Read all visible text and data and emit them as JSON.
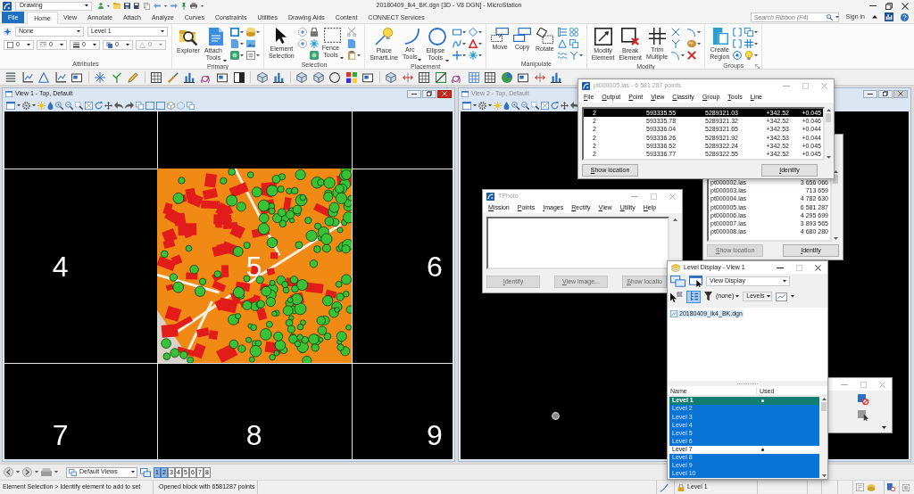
{
  "title_bar": {
    "workspace": "Drawing",
    "title": "20180409_lk4_BK.dgn [3D - V8 DGN] - MicroStation"
  },
  "ribbon": {
    "tabs": [
      {
        "label": "File",
        "kind": "backstage",
        "selected": false
      },
      {
        "label": "Home",
        "kind": "tab",
        "selected": true
      },
      {
        "label": "View",
        "kind": "tab",
        "selected": false
      },
      {
        "label": "Annotate",
        "kind": "tab",
        "selected": false
      },
      {
        "label": "Attach",
        "kind": "tab",
        "selected": false
      },
      {
        "label": "Analyze",
        "kind": "tab",
        "selected": false
      },
      {
        "label": "Curves",
        "kind": "tab",
        "selected": false
      },
      {
        "label": "Constraints",
        "kind": "tab",
        "selected": false
      },
      {
        "label": "Utilities",
        "kind": "tab",
        "selected": false
      },
      {
        "label": "Drawing Aids",
        "kind": "tab",
        "selected": false
      },
      {
        "label": "Content",
        "kind": "tab",
        "selected": false
      },
      {
        "label": "CONNECT Services",
        "kind": "tab",
        "selected": false
      }
    ],
    "search": {
      "placeholder": "Search Ribbon (F4)"
    },
    "sign_in": "Sign in",
    "groups": [
      {
        "label": "Attributes",
        "kind": "attributes",
        "dialog_launcher": false,
        "fields": [
          {
            "value": "None"
          },
          {
            "value": "Level 1"
          }
        ],
        "small_fields": [
          {
            "value": "0",
            "disabled": false
          },
          {
            "value": "0",
            "disabled": false
          },
          {
            "value": "0",
            "disabled": false
          },
          {
            "value": "0",
            "disabled": false
          },
          {
            "value": "0",
            "disabled": true
          }
        ]
      },
      {
        "label": "Primary",
        "kind": "tools",
        "dialog_launcher": false,
        "buttons": [
          {
            "label": "Explorer",
            "dropdown": false
          },
          {
            "label": "Attach Tools",
            "dropdown": true
          }
        ]
      },
      {
        "label": "Selection",
        "kind": "tools",
        "dialog_launcher": false,
        "buttons": [
          {
            "label": "Element Selection",
            "dropdown": false
          },
          {
            "label": "Fence Tools",
            "dropdown": true
          }
        ]
      },
      {
        "label": "Placement",
        "kind": "tools",
        "dialog_launcher": false,
        "buttons": [
          {
            "label": "Place SmartLine",
            "dropdown": false
          },
          {
            "label": "Arc Tools",
            "dropdown": true
          },
          {
            "label": "Ellipse Tools",
            "dropdown": true
          }
        ]
      },
      {
        "label": "Manipulate",
        "kind": "tools",
        "dialog_launcher": false,
        "buttons": [
          {
            "label": "Move",
            "dropdown": false
          },
          {
            "label": "Copy",
            "dropdown": false
          },
          {
            "label": "Rotate",
            "dropdown": false
          }
        ]
      },
      {
        "label": "Modify",
        "kind": "tools",
        "dialog_launcher": false,
        "buttons": [
          {
            "label": "Modify Element",
            "dropdown": false
          },
          {
            "label": "Break Element",
            "dropdown": false
          },
          {
            "label": "Trim Multiple",
            "dropdown": false
          }
        ]
      },
      {
        "label": "Groups",
        "kind": "tools",
        "dialog_launcher": true,
        "buttons": [
          {
            "label": "Create Region",
            "dropdown": false
          }
        ]
      }
    ]
  },
  "views": [
    {
      "title": "View 1 - Top, Default",
      "active": true,
      "cell_labels": [
        "4",
        "5",
        "6",
        "7",
        "8",
        "9"
      ]
    },
    {
      "title": "View 2 - Top, Default",
      "active": false
    }
  ],
  "point_list_window": {
    "title": "pt000005.las - 6 581 287 points",
    "active": false,
    "menu": [
      "File",
      "Output",
      "Point",
      "View",
      "Classify",
      "Group",
      "Tools",
      "Line"
    ],
    "rows": [
      {
        "cells": [
          "2",
          "593335.55",
          "5289321.03",
          "+342.52",
          "+0.045"
        ],
        "selected": true
      },
      {
        "cells": [
          "2",
          "593335.78",
          "5289321.32",
          "+342.52",
          "+0.046"
        ],
        "selected": false
      },
      {
        "cells": [
          "2",
          "593336.04",
          "5289321.65",
          "+342.53",
          "+0.044"
        ],
        "selected": false
      },
      {
        "cells": [
          "2",
          "593336.26",
          "5289321.92",
          "+342.53",
          "+0.044"
        ],
        "selected": false
      },
      {
        "cells": [
          "2",
          "593336.52",
          "5289322.24",
          "+342.52",
          "+0.045"
        ],
        "selected": false
      },
      {
        "cells": [
          "2",
          "593336.77",
          "5289322.55",
          "+342.52",
          "+0.045"
        ],
        "selected": false
      }
    ],
    "buttons": [
      {
        "label": "Show location",
        "disabled": false
      },
      {
        "label": "Identify",
        "disabled": false
      }
    ]
  },
  "file_list_window": {
    "rows": [
      {
        "file": "pt000002.las",
        "points": "3 656 066"
      },
      {
        "file": "pt000003.las",
        "points": "713 659"
      },
      {
        "file": "pt000004.las",
        "points": "4 782 630"
      },
      {
        "file": "pt000005.las",
        "points": "6 581 287"
      },
      {
        "file": "pt000006.las",
        "points": "4 295 699"
      },
      {
        "file": "pt000007.las",
        "points": "3 893 565"
      },
      {
        "file": "pt000008.las",
        "points": "4 680 280"
      }
    ],
    "buttons": [
      {
        "label": "Show location",
        "disabled": true
      },
      {
        "label": "Identify",
        "disabled": false
      }
    ]
  },
  "tphoto_window": {
    "title": "TPhoto",
    "active": false,
    "menu": [
      "Mission",
      "Points",
      "Images",
      "Rectify",
      "View",
      "Utility",
      "Help"
    ],
    "buttons": [
      {
        "label": "Identify",
        "disabled": true
      },
      {
        "label": "View image...",
        "disabled": true
      },
      {
        "label": "Show locatio",
        "disabled": true
      }
    ]
  },
  "level_display": {
    "title": "Level Display - View 1",
    "active": true,
    "display_mode": "View Display",
    "tree_toggle": {
      "on": true
    },
    "filter": "(none)",
    "list_mode": "Levels",
    "tree": [
      {
        "label": "20180409_lk4_BK.dgn",
        "selected": true
      }
    ],
    "columns": [
      "Name",
      "Used"
    ],
    "levels": [
      {
        "name": "Level 1",
        "used": true,
        "selected": true,
        "current": true
      },
      {
        "name": "Level 2",
        "used": false,
        "selected": true,
        "current": false
      },
      {
        "name": "Level 3",
        "used": false,
        "selected": true,
        "current": false
      },
      {
        "name": "Level 4",
        "used": false,
        "selected": true,
        "current": false
      },
      {
        "name": "Level 5",
        "used": false,
        "selected": true,
        "current": false
      },
      {
        "name": "Level 6",
        "used": false,
        "selected": true,
        "current": false
      },
      {
        "name": "Level 7",
        "used": true,
        "selected": false,
        "current": false
      },
      {
        "name": "Level 8",
        "used": false,
        "selected": true,
        "current": false
      },
      {
        "name": "Level 9",
        "used": false,
        "selected": true,
        "current": false
      },
      {
        "name": "Level 10",
        "used": false,
        "selected": true,
        "current": false
      }
    ]
  },
  "view_groups": {
    "selector": "Default Views",
    "views": [
      {
        "label": "1",
        "open": true
      },
      {
        "label": "2",
        "open": true
      },
      {
        "label": "3",
        "open": false
      },
      {
        "label": "4",
        "open": false
      },
      {
        "label": "5",
        "open": false
      },
      {
        "label": "6",
        "open": false
      },
      {
        "label": "7",
        "open": false
      },
      {
        "label": "8",
        "open": false
      }
    ]
  },
  "status_bar": {
    "prompt": "Element Selection > Identify element to add to set",
    "message": "Opened block with 6581287 points",
    "active_level": "Level 1"
  }
}
